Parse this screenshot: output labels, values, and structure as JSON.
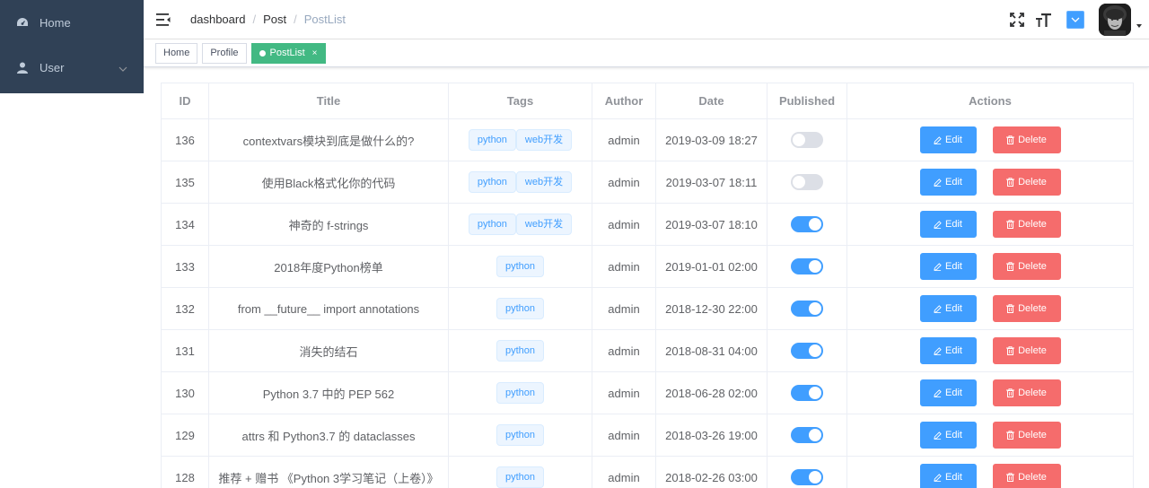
{
  "sidebar": {
    "items": [
      {
        "label": "Home",
        "icon": "dashboard-icon"
      },
      {
        "label": "User",
        "icon": "user-icon"
      }
    ]
  },
  "breadcrumb": [
    "dashboard",
    "Post",
    "PostList"
  ],
  "tags_view": [
    {
      "label": "Home",
      "active": false
    },
    {
      "label": "Profile",
      "active": false
    },
    {
      "label": "PostList",
      "active": true
    }
  ],
  "table": {
    "headers": [
      "ID",
      "Title",
      "Tags",
      "Author",
      "Date",
      "Published",
      "Actions"
    ],
    "edit_label": "Edit",
    "delete_label": "Delete",
    "rows": [
      {
        "id": "136",
        "title": "contextvars模块到底是做什么的?",
        "tags": [
          "python",
          "web开发"
        ],
        "author": "admin",
        "date": "2019-03-09 18:27",
        "published": false
      },
      {
        "id": "135",
        "title": "使用Black格式化你的代码",
        "tags": [
          "python",
          "web开发"
        ],
        "author": "admin",
        "date": "2019-03-07 18:11",
        "published": false
      },
      {
        "id": "134",
        "title": "神奇的 f-strings",
        "tags": [
          "python",
          "web开发"
        ],
        "author": "admin",
        "date": "2019-03-07 18:10",
        "published": true
      },
      {
        "id": "133",
        "title": "2018年度Python榜单",
        "tags": [
          "python"
        ],
        "author": "admin",
        "date": "2019-01-01 02:00",
        "published": true
      },
      {
        "id": "132",
        "title": "from __future__ import annotations",
        "tags": [
          "python"
        ],
        "author": "admin",
        "date": "2018-12-30 22:00",
        "published": true
      },
      {
        "id": "131",
        "title": "消失的结石",
        "tags": [
          "python"
        ],
        "author": "admin",
        "date": "2018-08-31 04:00",
        "published": true
      },
      {
        "id": "130",
        "title": "Python 3.7 中的 PEP 562",
        "tags": [
          "python"
        ],
        "author": "admin",
        "date": "2018-06-28 02:00",
        "published": true
      },
      {
        "id": "129",
        "title": "attrs 和 Python3.7 的 dataclasses",
        "tags": [
          "python"
        ],
        "author": "admin",
        "date": "2018-03-26 19:00",
        "published": true
      },
      {
        "id": "128",
        "title": "推荐 + 赠书 《Python 3学习笔记（上卷）》",
        "tags": [
          "python"
        ],
        "author": "admin",
        "date": "2018-02-26 03:00",
        "published": true
      }
    ]
  },
  "colors": {
    "sidebar_bg": "#304156",
    "primary": "#409eff",
    "danger": "#f56c6c",
    "active_tag": "#42b983"
  }
}
